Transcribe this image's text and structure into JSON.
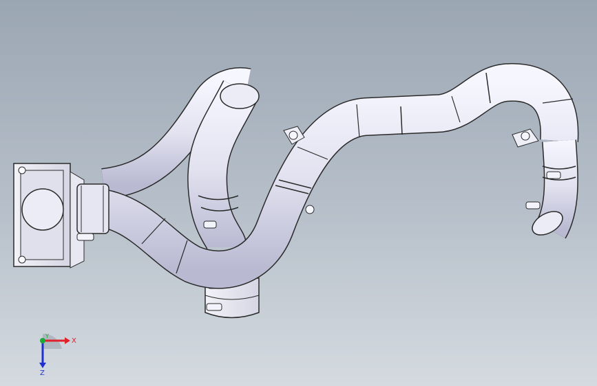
{
  "viewport": {
    "background_top": "#9ba6b3",
    "background_bottom": "#d4dae0",
    "part_fill": "#e4e4f2",
    "part_edge": "#2a2a2a"
  },
  "triad": {
    "x_label": "X",
    "y_label": "Y",
    "z_label": "Z",
    "x_color": "#e0202a",
    "y_color": "#1ea838",
    "z_color": "#2030d0"
  }
}
